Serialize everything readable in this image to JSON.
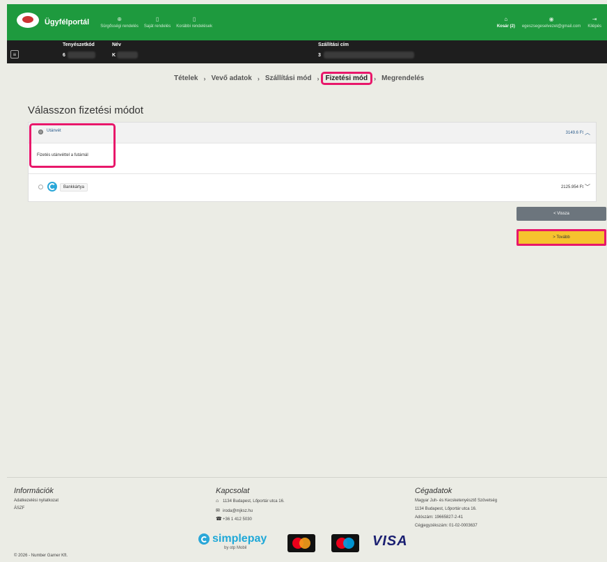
{
  "nav": {
    "brand": "Ügyfélportál",
    "links": [
      {
        "label": "Sürgősségi rendelés",
        "icon": "globe-icon"
      },
      {
        "label": "Saját rendelés",
        "icon": "document-icon"
      },
      {
        "label": "Korábbi rendelések",
        "icon": "document-icon"
      }
    ],
    "cart": "Kosár (2)",
    "email": "egeszsegeselvezet@gmail.com",
    "logout": "Kilépés"
  },
  "infobar": {
    "col1_header": "Tenyészetkód",
    "col1_value": "6",
    "col2_header": "Név",
    "col2_value": "K",
    "col3_header": "Szállítási cím",
    "col3_value": "3"
  },
  "stepper": {
    "steps": [
      "Tételek",
      "Vevő adatok",
      "Szállítási mód",
      "Fizetési mód",
      "Megrendelés"
    ],
    "active_index": 3
  },
  "page_title": "Válasszon fizetési módot",
  "payment": {
    "option1": {
      "label": "Utánvét",
      "price": "3149.6 Ft",
      "description": "Fizetés utánvéttel a futárnál",
      "selected": true
    },
    "option2": {
      "label": "Bankkártya",
      "price": "2125.954 Ft",
      "selected": false
    }
  },
  "buttons": {
    "back": "< Vissza",
    "next": "> Tovább"
  },
  "footer": {
    "info_title": "Információk",
    "info_links": [
      "Adatkezelési nyilatkozat",
      "ÁSZF"
    ],
    "contact_title": "Kapcsolat",
    "contact_address": "1134 Budapest, Lőportár utca 16.",
    "contact_email": "iroda@mjksz.hu",
    "contact_phone": "+36 1 412 5030",
    "company_title": "Cégadatok",
    "company_lines": [
      "Magyar Juh- és Kecsketenyésztő Szövetség",
      "1134 Budapest, Lőportár utca 16.",
      "Adószám: 19665827-2-41",
      "Cégjegyzékszám: 01-02-0003637"
    ],
    "copyright": "© 2026 - Number Garner Kft.",
    "simplepay": "simplepay",
    "simplepay_sub": "by otp Mobil",
    "visa": "VISA"
  },
  "colors": {
    "nav_green": "#1e9a3e",
    "highlight": "#e8176a",
    "next_button": "#f6c22e",
    "back_button": "#6c757d"
  }
}
